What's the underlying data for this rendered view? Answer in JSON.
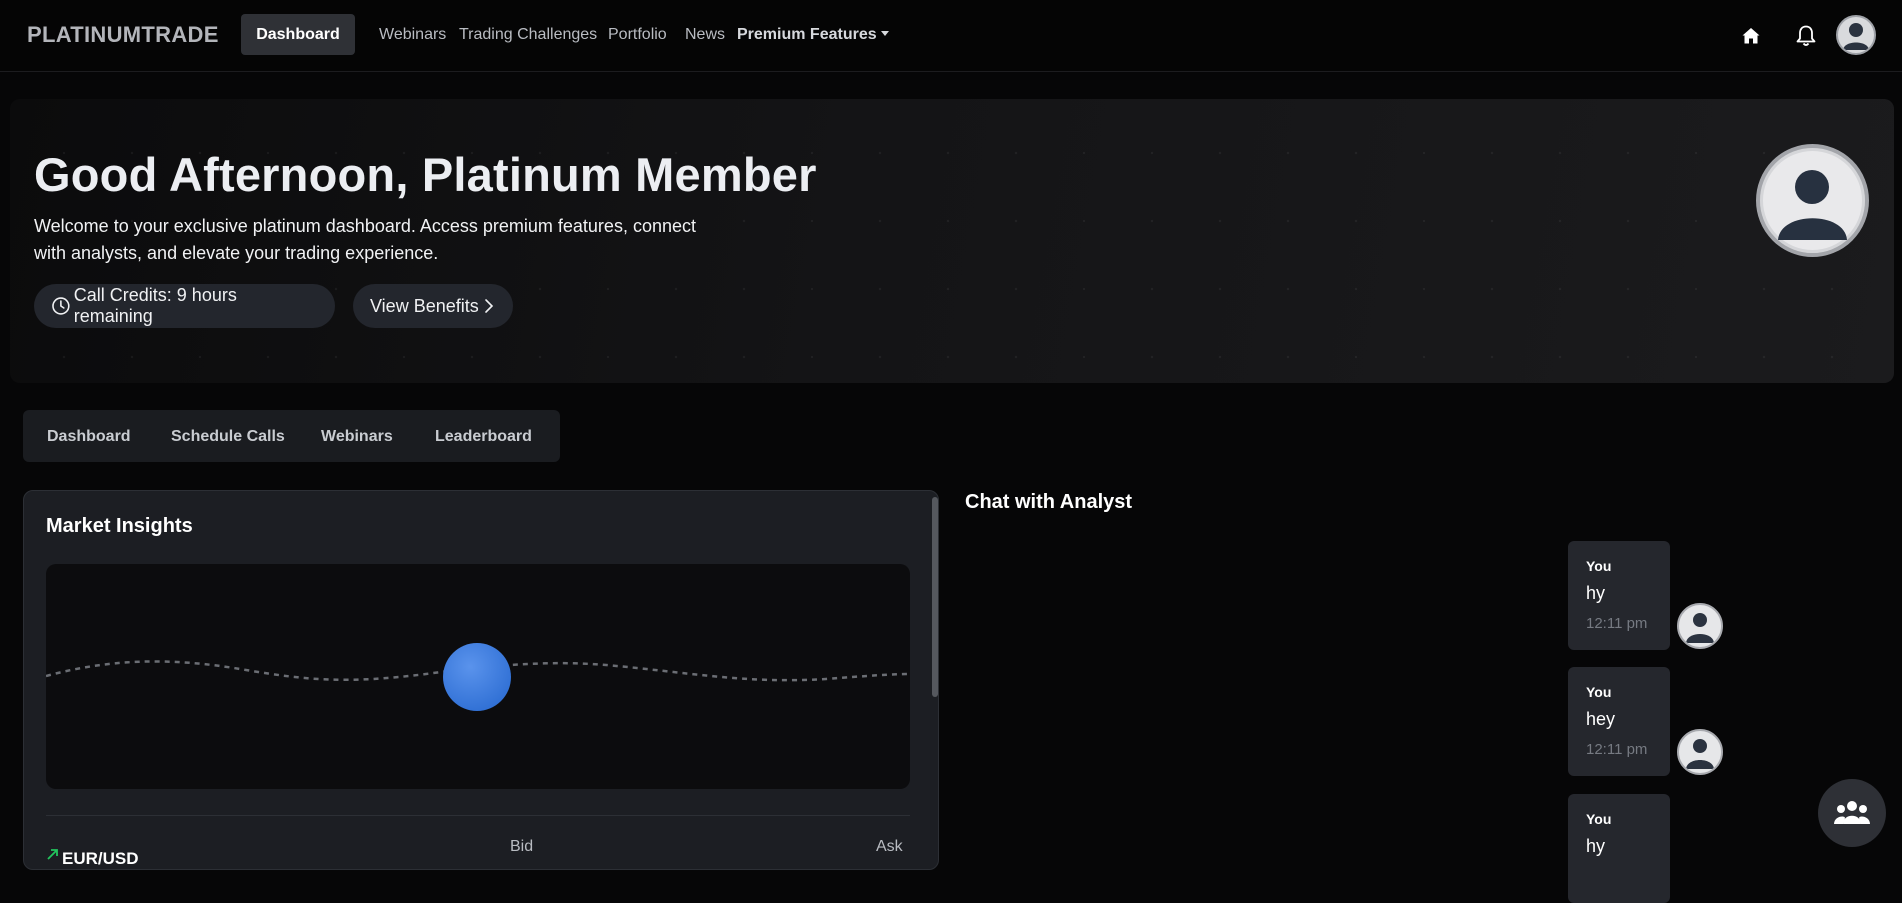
{
  "navbar": {
    "brand": "PLATINUMTRADE",
    "active": "Dashboard",
    "links": [
      "Webinars",
      "Trading Challenges",
      "Portfolio",
      "News"
    ],
    "premium": "Premium Features",
    "icons": [
      "home-icon",
      "bell-icon",
      "user-avatar-icon"
    ]
  },
  "hero": {
    "greeting": "Good Afternoon, Platinum Member",
    "line1": "Welcome to your exclusive platinum dashboard. Access premium features, connect",
    "line2": "with analysts, and elevate your trading experience.",
    "credits": "Call Credits: 9 hours remaining",
    "benefits": "View Benefits"
  },
  "tabs": [
    "Dashboard",
    "Schedule Calls",
    "Webinars",
    "Leaderboard"
  ],
  "market": {
    "title": "Market Insights",
    "pair": "EUR/USD",
    "bid_label": "Bid",
    "ask_label": "Ask"
  },
  "chat": {
    "title": "Chat with Analyst",
    "messages": [
      {
        "sender": "You",
        "text": "hy",
        "time": "12:11 pm"
      },
      {
        "sender": "You",
        "text": "hey",
        "time": "12:11 pm"
      },
      {
        "sender": "You",
        "text": "hy",
        "time": ""
      }
    ]
  },
  "colors": {
    "accent_blue": "#3d7be0",
    "background": "#060607",
    "card": "#1c1e23"
  }
}
